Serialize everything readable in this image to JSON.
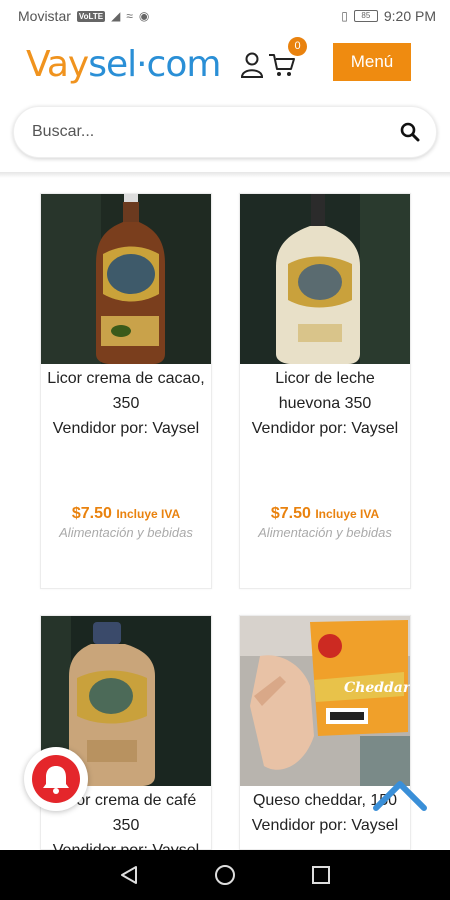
{
  "status_bar": {
    "carrier": "Movistar",
    "network_badge": "VoLTE",
    "battery": "85",
    "time": "9:20 PM"
  },
  "header": {
    "logo_v": "Vay",
    "logo_rest": "sel·com",
    "cart_count": "0",
    "menu_label": "Menú"
  },
  "search": {
    "placeholder": "Buscar..."
  },
  "products": [
    {
      "title_line1": "Licor crema de cacao,",
      "title_line2": "350",
      "vendor": "Vendidor por: Vaysel",
      "price": "$7.50",
      "price_note": "Incluye IVA",
      "category": "Alimentación y bebidas"
    },
    {
      "title_line1": "Licor de leche",
      "title_line2": "huevona 350",
      "vendor": "Vendidor por: Vaysel",
      "price": "$7.50",
      "price_note": "Incluye IVA",
      "category": "Alimentación y bebidas"
    },
    {
      "title_line1": "Licor crema de café",
      "title_line2": "350",
      "vendor": "Vendidor por: Vaysel"
    },
    {
      "title_line1": "Queso cheddar, 150",
      "vendor": "Vendidor por: Vaysel",
      "label_text": "Cheddar"
    }
  ],
  "colors": {
    "accent_orange": "#ef8b10",
    "logo_blue": "#2a8fd6",
    "bell_red": "#e4262b"
  }
}
